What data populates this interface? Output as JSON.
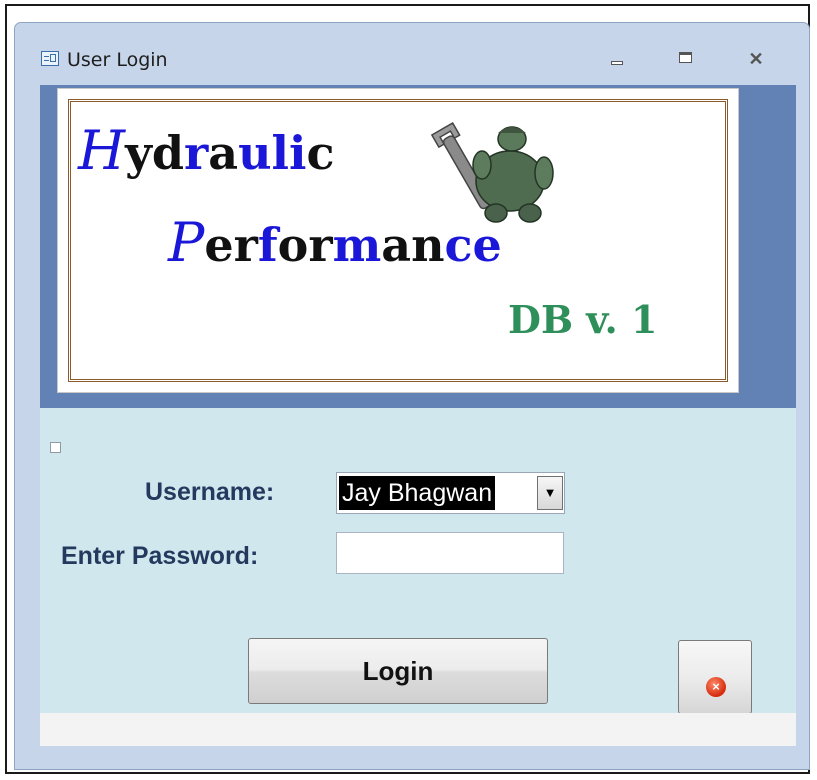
{
  "window": {
    "title": "User Login"
  },
  "logo": {
    "line1_cap": "H",
    "line1_a": "yd",
    "line1_b": "r",
    "line1_c": "a",
    "line1_d": "uli",
    "line1_e": "c",
    "line2_cap": "P",
    "line2_a": "er",
    "line2_b": "f",
    "line2_c": "or",
    "line2_d": "m",
    "line2_e": "an",
    "line2_f": "ce",
    "version": "DB v. 1"
  },
  "form": {
    "username_label": "Username:",
    "username_value": "Jay Bhagwan",
    "password_label": "Enter Password:",
    "password_value": "",
    "login_label": "Login"
  },
  "colors": {
    "title_bar": "#c6d5ea",
    "header_band": "#6282b5",
    "body_panel": "#d1e7ee",
    "logo_blue": "#1a17d8",
    "logo_green": "#2f8f5a",
    "label_text": "#233a5e"
  }
}
